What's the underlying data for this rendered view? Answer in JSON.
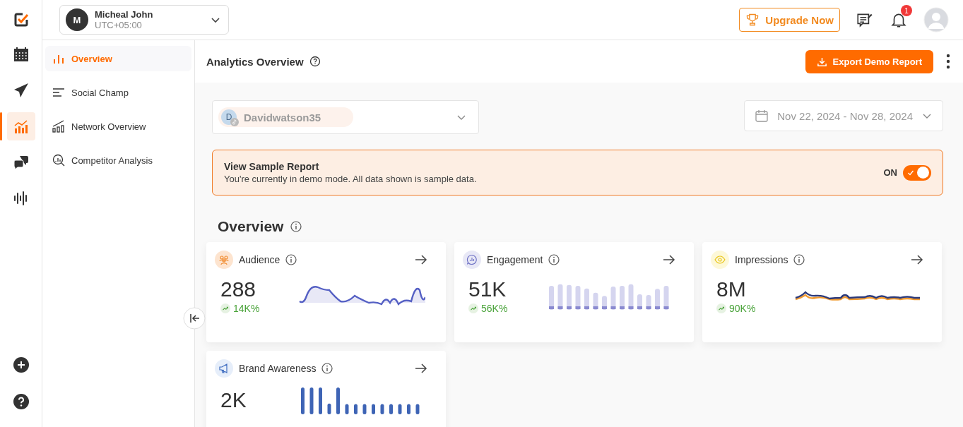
{
  "rail": {
    "items": [
      {
        "kind": "calendar",
        "selected": false
      },
      {
        "kind": "send",
        "selected": false
      },
      {
        "kind": "analytics",
        "selected": true
      },
      {
        "kind": "chat",
        "selected": false
      },
      {
        "kind": "wave",
        "selected": false
      }
    ],
    "bottom": [
      {
        "kind": "plus"
      },
      {
        "kind": "help"
      }
    ]
  },
  "account": {
    "initial": "M",
    "name": "Micheal John",
    "timezone": "UTC+05:00"
  },
  "topbar": {
    "upgrade": "Upgrade Now",
    "notifications": "1"
  },
  "subnav": [
    {
      "label": "Overview",
      "kind": "bars",
      "selected": true
    },
    {
      "label": "Social Champ",
      "kind": "lines",
      "selected": false
    },
    {
      "label": "Network Overview",
      "kind": "growth",
      "selected": false
    },
    {
      "label": "Competitor Analysis",
      "kind": "magnifier",
      "selected": false
    }
  ],
  "header": {
    "title": "Analytics Overview",
    "export": "Export Demo Report"
  },
  "profile_select": {
    "initial": "D",
    "name": "Davidwatson35"
  },
  "date_range": "Nov 22, 2024 - Nov 28, 2024",
  "banner": {
    "title": "View Sample Report",
    "text": "You're currently in demo mode. All data shown is sample data.",
    "toggle": {
      "label": "ON",
      "on": true
    }
  },
  "section_title": "Overview",
  "cards": [
    {
      "title": "Audience",
      "kind": "audience",
      "value": "288",
      "change": "14K%"
    },
    {
      "title": "Engagement",
      "kind": "engagement",
      "value": "51K",
      "change": "56K%"
    },
    {
      "title": "Impressions",
      "kind": "impressions",
      "value": "8M",
      "change": "90K%"
    },
    {
      "title": "Brand Awareness",
      "kind": "brand",
      "value": "2K"
    }
  ]
}
